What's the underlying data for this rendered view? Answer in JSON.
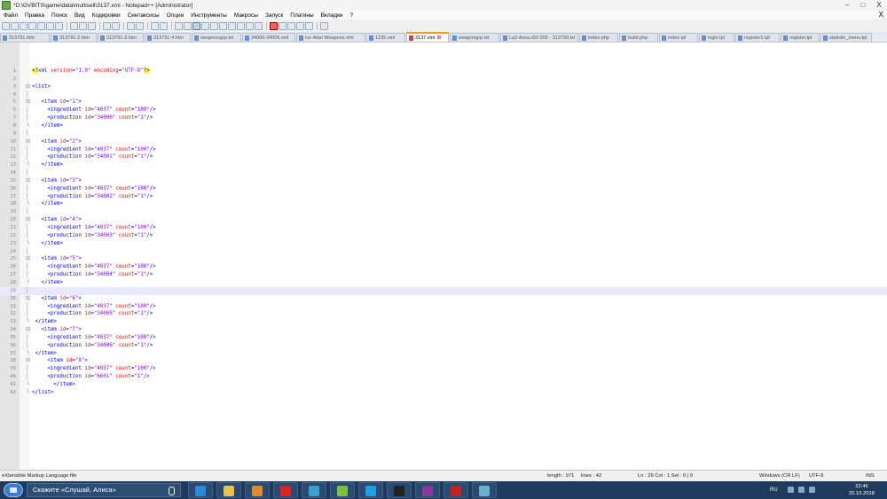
{
  "window": {
    "title": "*D:\\GVBITS\\game\\data\\multisell\\3137.xml - Notepad++ [Administrator]",
    "controls": [
      "–",
      "□",
      "X"
    ]
  },
  "menu": {
    "items": [
      "Файл",
      "Правка",
      "Поиск",
      "Вид",
      "Кодировки",
      "Синтаксисы",
      "Опции",
      "Инструменты",
      "Макросы",
      "Запуск",
      "Плагины",
      "Вкладки",
      "?"
    ],
    "close": "X"
  },
  "tabs": [
    {
      "label": "313791.htm",
      "active": false
    },
    {
      "label": "313791-2.htm",
      "active": false
    },
    {
      "label": "313791-3.htm",
      "active": false
    },
    {
      "label": "313791-4.htm",
      "active": false
    },
    {
      "label": "weaponsgrp.txt",
      "active": false
    },
    {
      "label": "34000-34006.xml",
      "active": false
    },
    {
      "label": "Ice Atari Weapons.xml",
      "active": false
    },
    {
      "label": "1235.xml",
      "active": false
    },
    {
      "label": "3137.xml",
      "active": true
    },
    {
      "label": "weapongrp.txt",
      "active": false
    },
    {
      "label": "La2-Area.x50 000 - 313790.txt",
      "active": false
    },
    {
      "label": "index.php",
      "active": false
    },
    {
      "label": "build.php",
      "active": false
    },
    {
      "label": "index.tpl",
      "active": false
    },
    {
      "label": "login.tpl",
      "active": false
    },
    {
      "label": "register1.tpl",
      "active": false
    },
    {
      "label": "register.tpl",
      "active": false
    },
    {
      "label": "statistic_menu.tpl",
      "active": false
    }
  ],
  "editor": {
    "current_line": 29,
    "lines": [
      {
        "n": "1",
        "fold": "",
        "segs": [
          [
            "pi",
            "<?"
          ],
          [
            "tag",
            "xml "
          ],
          [
            "attr",
            "version"
          ],
          [
            "tag",
            "="
          ],
          [
            "val",
            "\"1.0\""
          ],
          [
            "tag",
            " "
          ],
          [
            "attr",
            "encoding"
          ],
          [
            "tag",
            "="
          ],
          [
            "val",
            "\"UTF-8\""
          ],
          [
            "pi",
            "?>"
          ]
        ]
      },
      {
        "n": "2",
        "fold": "",
        "segs": []
      },
      {
        "n": "3",
        "fold": "⊟",
        "segs": [
          [
            "tag",
            "<list>"
          ]
        ]
      },
      {
        "n": "4",
        "fold": "│",
        "segs": []
      },
      {
        "n": "5",
        "fold": "⊟",
        "segs": [
          [
            "tag",
            "   <item "
          ],
          [
            "attr",
            "id"
          ],
          [
            "tag",
            "="
          ],
          [
            "val",
            "\"1\""
          ],
          [
            "tag",
            ">"
          ]
        ]
      },
      {
        "n": "6",
        "fold": "│",
        "segs": [
          [
            "tag",
            "     <ingredient "
          ],
          [
            "attr",
            "id"
          ],
          [
            "tag",
            "="
          ],
          [
            "val",
            "\"4037\""
          ],
          [
            "tag",
            " "
          ],
          [
            "attr",
            "count"
          ],
          [
            "tag",
            "="
          ],
          [
            "val",
            "\"100\""
          ],
          [
            "tag",
            "/>"
          ]
        ]
      },
      {
        "n": "7",
        "fold": "│",
        "segs": [
          [
            "tag",
            "     <production "
          ],
          [
            "attr",
            "id"
          ],
          [
            "tag",
            "="
          ],
          [
            "val",
            "\"34000\""
          ],
          [
            "tag",
            " "
          ],
          [
            "attr",
            "count"
          ],
          [
            "tag",
            "="
          ],
          [
            "val",
            "\"1\""
          ],
          [
            "tag",
            "/>"
          ]
        ]
      },
      {
        "n": "8",
        "fold": "└",
        "segs": [
          [
            "tag",
            "   </item>"
          ]
        ]
      },
      {
        "n": "9",
        "fold": "│",
        "segs": []
      },
      {
        "n": "10",
        "fold": "⊟",
        "segs": [
          [
            "tag",
            "   <item "
          ],
          [
            "attr",
            "id"
          ],
          [
            "tag",
            "="
          ],
          [
            "val",
            "\"2\""
          ],
          [
            "tag",
            ">"
          ]
        ]
      },
      {
        "n": "11",
        "fold": "│",
        "segs": [
          [
            "tag",
            "     <ingredient "
          ],
          [
            "attr",
            "id"
          ],
          [
            "tag",
            "="
          ],
          [
            "val",
            "\"4037\""
          ],
          [
            "tag",
            " "
          ],
          [
            "attr",
            "count"
          ],
          [
            "tag",
            "="
          ],
          [
            "val",
            "\"100\""
          ],
          [
            "tag",
            "/>"
          ]
        ]
      },
      {
        "n": "12",
        "fold": "│",
        "segs": [
          [
            "tag",
            "     <production "
          ],
          [
            "attr",
            "id"
          ],
          [
            "tag",
            "="
          ],
          [
            "val",
            "\"34001\""
          ],
          [
            "tag",
            " "
          ],
          [
            "attr",
            "count"
          ],
          [
            "tag",
            "="
          ],
          [
            "val",
            "\"1\""
          ],
          [
            "tag",
            "/>"
          ]
        ]
      },
      {
        "n": "13",
        "fold": "└",
        "segs": [
          [
            "tag",
            "   </item>"
          ]
        ]
      },
      {
        "n": "14",
        "fold": "│",
        "segs": []
      },
      {
        "n": "15",
        "fold": "⊟",
        "segs": [
          [
            "tag",
            "   <item "
          ],
          [
            "attr",
            "id"
          ],
          [
            "tag",
            "="
          ],
          [
            "val",
            "\"3\""
          ],
          [
            "tag",
            ">"
          ]
        ]
      },
      {
        "n": "16",
        "fold": "│",
        "segs": [
          [
            "tag",
            "     <ingredient "
          ],
          [
            "attr",
            "id"
          ],
          [
            "tag",
            "="
          ],
          [
            "val",
            "\"4037\""
          ],
          [
            "tag",
            " "
          ],
          [
            "attr",
            "count"
          ],
          [
            "tag",
            "="
          ],
          [
            "val",
            "\"100\""
          ],
          [
            "tag",
            "/>"
          ]
        ]
      },
      {
        "n": "17",
        "fold": "│",
        "segs": [
          [
            "tag",
            "     <production "
          ],
          [
            "attr",
            "id"
          ],
          [
            "tag",
            "="
          ],
          [
            "val",
            "\"34002\""
          ],
          [
            "tag",
            " "
          ],
          [
            "attr",
            "count"
          ],
          [
            "tag",
            "="
          ],
          [
            "val",
            "\"1\""
          ],
          [
            "tag",
            "/>"
          ]
        ]
      },
      {
        "n": "18",
        "fold": "└",
        "segs": [
          [
            "tag",
            "   </item>"
          ]
        ]
      },
      {
        "n": "19",
        "fold": "│",
        "segs": []
      },
      {
        "n": "20",
        "fold": "⊟",
        "segs": [
          [
            "tag",
            "   <item "
          ],
          [
            "attr",
            "id"
          ],
          [
            "tag",
            "="
          ],
          [
            "val",
            "\"4\""
          ],
          [
            "tag",
            ">"
          ]
        ]
      },
      {
        "n": "21",
        "fold": "│",
        "segs": [
          [
            "tag",
            "     <ingredient "
          ],
          [
            "attr",
            "id"
          ],
          [
            "tag",
            "="
          ],
          [
            "val",
            "\"4037\""
          ],
          [
            "tag",
            " "
          ],
          [
            "attr",
            "count"
          ],
          [
            "tag",
            "="
          ],
          [
            "val",
            "\"100\""
          ],
          [
            "tag",
            "/>"
          ]
        ]
      },
      {
        "n": "22",
        "fold": "│",
        "segs": [
          [
            "tag",
            "     <production "
          ],
          [
            "attr",
            "id"
          ],
          [
            "tag",
            "="
          ],
          [
            "val",
            "\"34003\""
          ],
          [
            "tag",
            " "
          ],
          [
            "attr",
            "count"
          ],
          [
            "tag",
            "="
          ],
          [
            "val",
            "\"1\""
          ],
          [
            "tag",
            "/>"
          ]
        ]
      },
      {
        "n": "23",
        "fold": "└",
        "segs": [
          [
            "tag",
            "   </item>"
          ]
        ]
      },
      {
        "n": "24",
        "fold": "│",
        "segs": []
      },
      {
        "n": "25",
        "fold": "⊟",
        "segs": [
          [
            "tag",
            "   <item "
          ],
          [
            "attr",
            "id"
          ],
          [
            "tag",
            "="
          ],
          [
            "val",
            "\"5\""
          ],
          [
            "tag",
            ">"
          ]
        ]
      },
      {
        "n": "26",
        "fold": "│",
        "segs": [
          [
            "tag",
            "     <ingredient "
          ],
          [
            "attr",
            "id"
          ],
          [
            "tag",
            "="
          ],
          [
            "val",
            "\"4037\""
          ],
          [
            "tag",
            " "
          ],
          [
            "attr",
            "count"
          ],
          [
            "tag",
            "="
          ],
          [
            "val",
            "\"100\""
          ],
          [
            "tag",
            "/>"
          ]
        ]
      },
      {
        "n": "27",
        "fold": "│",
        "segs": [
          [
            "tag",
            "     <production "
          ],
          [
            "attr",
            "id"
          ],
          [
            "tag",
            "="
          ],
          [
            "val",
            "\"34004\""
          ],
          [
            "tag",
            " "
          ],
          [
            "attr",
            "count"
          ],
          [
            "tag",
            "="
          ],
          [
            "val",
            "\"1\""
          ],
          [
            "tag",
            "/>"
          ]
        ]
      },
      {
        "n": "28",
        "fold": "└",
        "segs": [
          [
            "tag",
            "   </item>"
          ]
        ]
      },
      {
        "n": "29",
        "fold": "│",
        "segs": []
      },
      {
        "n": "30",
        "fold": "⊟",
        "segs": [
          [
            "tag",
            "   <item "
          ],
          [
            "attr",
            "id"
          ],
          [
            "tag",
            "="
          ],
          [
            "val",
            "\"6\""
          ],
          [
            "tag",
            ">"
          ]
        ]
      },
      {
        "n": "31",
        "fold": "│",
        "segs": [
          [
            "tag",
            "     <ingredient "
          ],
          [
            "attr",
            "id"
          ],
          [
            "tag",
            "="
          ],
          [
            "val",
            "\"4037\""
          ],
          [
            "tag",
            " "
          ],
          [
            "attr",
            "count"
          ],
          [
            "tag",
            "="
          ],
          [
            "val",
            "\"100\""
          ],
          [
            "tag",
            "/>"
          ]
        ]
      },
      {
        "n": "32",
        "fold": "│",
        "segs": [
          [
            "tag",
            "     <production "
          ],
          [
            "attr",
            "id"
          ],
          [
            "tag",
            "="
          ],
          [
            "val",
            "\"34005\""
          ],
          [
            "tag",
            " "
          ],
          [
            "attr",
            "count"
          ],
          [
            "tag",
            "="
          ],
          [
            "val",
            "\"1\""
          ],
          [
            "tag",
            "/>"
          ]
        ]
      },
      {
        "n": "33",
        "fold": "└",
        "segs": [
          [
            "tag",
            " </item>"
          ]
        ]
      },
      {
        "n": "34",
        "fold": "⊟",
        "segs": [
          [
            "tag",
            "   <item "
          ],
          [
            "attr",
            "id"
          ],
          [
            "tag",
            "="
          ],
          [
            "val",
            "\"7\""
          ],
          [
            "tag",
            ">"
          ]
        ]
      },
      {
        "n": "35",
        "fold": "│",
        "segs": [
          [
            "tag",
            "     <ingredient "
          ],
          [
            "attr",
            "id"
          ],
          [
            "tag",
            "="
          ],
          [
            "val",
            "\"4037\""
          ],
          [
            "tag",
            " "
          ],
          [
            "attr",
            "count"
          ],
          [
            "tag",
            "="
          ],
          [
            "val",
            "\"100\""
          ],
          [
            "tag",
            "/>"
          ]
        ]
      },
      {
        "n": "36",
        "fold": "│",
        "segs": [
          [
            "tag",
            "     <production "
          ],
          [
            "attr",
            "id"
          ],
          [
            "tag",
            "="
          ],
          [
            "val",
            "\"34006\""
          ],
          [
            "tag",
            " "
          ],
          [
            "attr",
            "count"
          ],
          [
            "tag",
            "="
          ],
          [
            "val",
            "\"1\""
          ],
          [
            "tag",
            "/>"
          ]
        ]
      },
      {
        "n": "37",
        "fold": "└",
        "segs": [
          [
            "tag",
            " </item>"
          ]
        ]
      },
      {
        "n": "38",
        "fold": "⊟",
        "segs": [
          [
            "tag",
            "     <item "
          ],
          [
            "attr",
            "id"
          ],
          [
            "tag",
            "="
          ],
          [
            "val",
            "\"8\""
          ],
          [
            "tag",
            ">"
          ]
        ]
      },
      {
        "n": "39",
        "fold": "│",
        "segs": [
          [
            "tag",
            "     <ingredient "
          ],
          [
            "attr",
            "id"
          ],
          [
            "tag",
            "="
          ],
          [
            "val",
            "\"4037\""
          ],
          [
            "tag",
            " "
          ],
          [
            "attr",
            "count"
          ],
          [
            "tag",
            "="
          ],
          [
            "val",
            "\"100\""
          ],
          [
            "tag",
            "/>"
          ]
        ]
      },
      {
        "n": "40",
        "fold": "│",
        "segs": [
          [
            "tag",
            "     <production "
          ],
          [
            "attr",
            "id"
          ],
          [
            "tag",
            "="
          ],
          [
            "val",
            "\"6601\""
          ],
          [
            "tag",
            " "
          ],
          [
            "attr",
            "count"
          ],
          [
            "tag",
            "="
          ],
          [
            "val",
            "\"1\""
          ],
          [
            "tag",
            "/>"
          ]
        ]
      },
      {
        "n": "41",
        "fold": "└",
        "segs": [
          [
            "tag",
            "       </item>"
          ]
        ]
      },
      {
        "n": "42",
        "fold": "└",
        "segs": [
          [
            "tag",
            "</list>"
          ]
        ]
      }
    ]
  },
  "status": {
    "file_type": "eXtensible Markup Language file",
    "length": "length : 971",
    "lines": "lines : 42",
    "position": "Ln : 29    Col : 1    Sel : 0 | 0",
    "eol": "Windows (CR LF)",
    "encoding": "UTF-8",
    "mode": "INS"
  },
  "taskbar": {
    "search_text": "Скажите «Слушай, Алиса»",
    "lang": "RU",
    "time": "22:46",
    "date": "25.10.2018",
    "apps": [
      {
        "name": "ie-icon",
        "color": "#2a8ad8"
      },
      {
        "name": "folder-icon",
        "color": "#e8c14e"
      },
      {
        "name": "media-player-icon",
        "color": "#e08a2a"
      },
      {
        "name": "yandex-icon",
        "color": "#e02020"
      },
      {
        "name": "app-circle-icon",
        "color": "#3aa0d0"
      },
      {
        "name": "notepad-plus-plus-icon",
        "color": "#7fbf3f"
      },
      {
        "name": "skype-icon",
        "color": "#1ea0e0"
      },
      {
        "name": "cmd-icon",
        "color": "#222222"
      },
      {
        "name": "winrar-icon",
        "color": "#8a3a9a"
      },
      {
        "name": "filezilla-icon",
        "color": "#c8201e"
      },
      {
        "name": "storage-icon",
        "color": "#6ab0d0"
      }
    ]
  }
}
